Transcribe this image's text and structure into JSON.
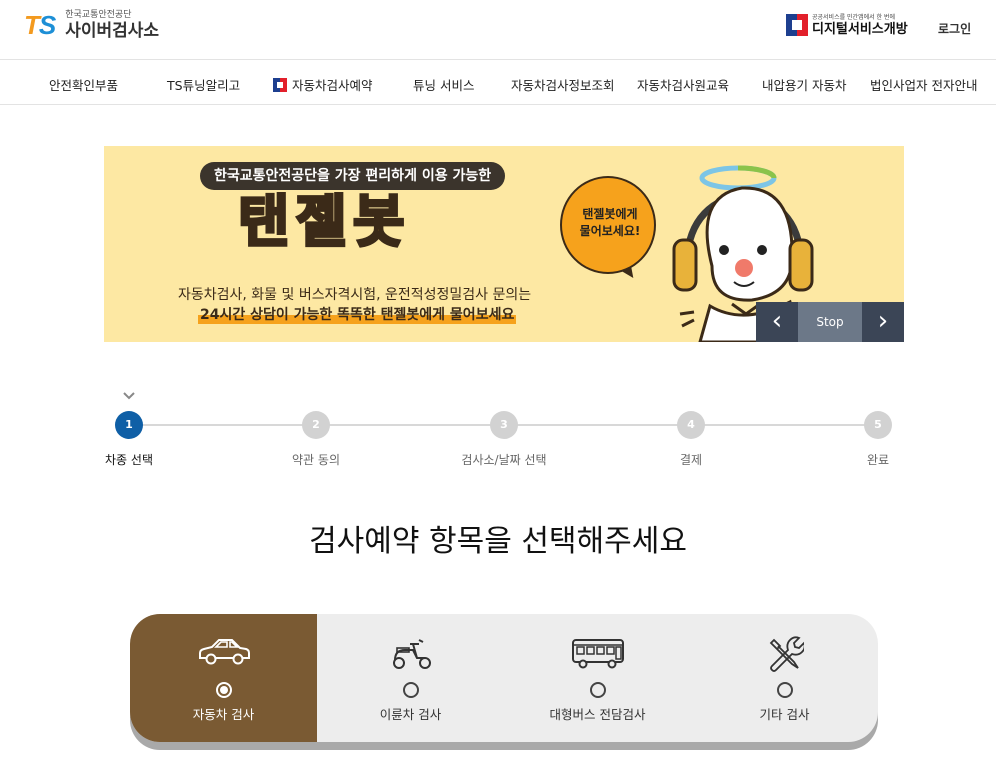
{
  "header": {
    "logo_mark_t": "T",
    "logo_mark_s": "S",
    "org_name": "한국교통안전공단",
    "site_name": "사이버검사소",
    "digital_tagline": "공공서비스를 민간앱에서 한 번에",
    "digital_name": "디지털서비스개방",
    "login": "로그인"
  },
  "nav": {
    "items": [
      {
        "label": "안전확인부품"
      },
      {
        "label": "TS튜닝알리고"
      },
      {
        "label": "자동차검사예약"
      },
      {
        "label": "튜닝 서비스"
      },
      {
        "label": "자동차검사정보조회"
      },
      {
        "label": "자동차검사원교육"
      },
      {
        "label": "내압용기 자동차"
      },
      {
        "label": "법인사업자 전자안내"
      }
    ]
  },
  "banner": {
    "pill": "한국교통안전공단을 가장 편리하게 이용 가능한",
    "title": "탠젤봇",
    "line1": "자동차검사, 화물 및 버스자격시험, 운전적성정밀검사 문의는",
    "line2": "24시간 상담이 가능한 똑똑한 탠젤봇에게 물어보세요",
    "bubble_line1": "탠젤봇에게",
    "bubble_line2": "물어보세요!",
    "prev_icon": "chevron-left-icon",
    "next_icon": "chevron-right-icon",
    "prev": "‹",
    "stop": "Stop",
    "next": "›"
  },
  "steps": {
    "current": 1,
    "items": [
      {
        "num": "1",
        "label": "차종 선택"
      },
      {
        "num": "2",
        "label": "약관 동의"
      },
      {
        "num": "3",
        "label": "검사소/날짜 선택"
      },
      {
        "num": "4",
        "label": "결제"
      },
      {
        "num": "5",
        "label": "완료"
      }
    ]
  },
  "heading": "검사예약 항목을 선택해주세요",
  "options": {
    "selected_index": 0,
    "items": [
      {
        "label": "자동차 검사",
        "icon": "car-icon"
      },
      {
        "label": "이륜차 검사",
        "icon": "scooter-icon"
      },
      {
        "label": "대형버스 전담검사",
        "icon": "bus-icon"
      },
      {
        "label": "기타 검사",
        "icon": "tools-icon"
      }
    ]
  },
  "colors": {
    "selected_option": "#7a5a33",
    "active_step": "#0f5fa6",
    "banner_bg": "#fde8a3",
    "accent_orange": "#f6a21c"
  }
}
